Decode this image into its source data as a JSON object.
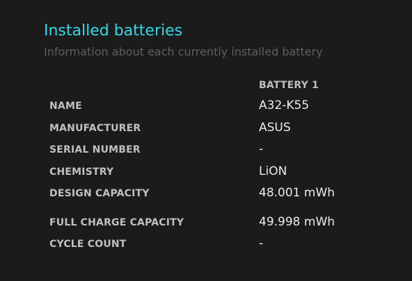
{
  "section": {
    "title": "Installed batteries",
    "subtitle": "Information about each currently installed battery"
  },
  "table": {
    "column_header": "BATTERY 1",
    "rows": [
      {
        "label": "NAME",
        "value": "A32-K55"
      },
      {
        "label": "MANUFACTURER",
        "value": "ASUS"
      },
      {
        "label": "SERIAL NUMBER",
        "value": "-"
      },
      {
        "label": "CHEMISTRY",
        "value": "LiON"
      },
      {
        "label": "DESIGN CAPACITY",
        "value": "48.001 mWh"
      },
      {
        "label": "FULL CHARGE CAPACITY",
        "value": "49.998 mWh"
      },
      {
        "label": "CYCLE COUNT",
        "value": "-"
      }
    ]
  },
  "colors": {
    "background": "#1b1b1b",
    "title": "#2fd9e6",
    "subtitle": "#5f5f5f",
    "label": "#c0c0c0",
    "value": "#ececec"
  }
}
